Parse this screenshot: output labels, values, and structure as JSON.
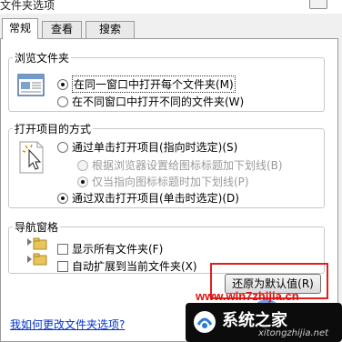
{
  "window": {
    "title": "文件夹选项"
  },
  "tabs": [
    {
      "label": "常规",
      "active": true
    },
    {
      "label": "查看",
      "active": false
    },
    {
      "label": "搜索",
      "active": false
    }
  ],
  "browse_folders": {
    "legend": "浏览文件夹",
    "options": [
      {
        "label": "在同一窗口中打开每个文件夹(M)",
        "checked": true
      },
      {
        "label": "在不同窗口中打开不同的文件夹(W)",
        "checked": false
      }
    ]
  },
  "open_items": {
    "legend": "打开项目的方式",
    "single_click": {
      "label": "通过单击打开项目(指向时选定)(S)",
      "checked": false
    },
    "sub_options": [
      {
        "label": "根据浏览器设置给图标标题加下划线(B)",
        "checked": false,
        "disabled": true
      },
      {
        "label": "仅当指向图标标题时加下划线(P)",
        "checked": true,
        "disabled": true
      }
    ],
    "double_click": {
      "label": "通过双击打开项目(单击时选定)(D)",
      "checked": true
    }
  },
  "nav_pane": {
    "legend": "导航窗格",
    "options": [
      {
        "label": "显示所有文件夹(F)",
        "checked": false
      },
      {
        "label": "自动扩展到当前文件夹(X)",
        "checked": false
      }
    ]
  },
  "restore_defaults_label": "还原为默认值(R)",
  "help_link": "我如何更改文件夹选项?",
  "watermark": {
    "url": "www.win7zhijia.cn",
    "brand": "系统之家",
    "site": "xitongzhijia.net"
  },
  "colors": {
    "highlight_box": "#e02020",
    "link": "#0033cc"
  }
}
